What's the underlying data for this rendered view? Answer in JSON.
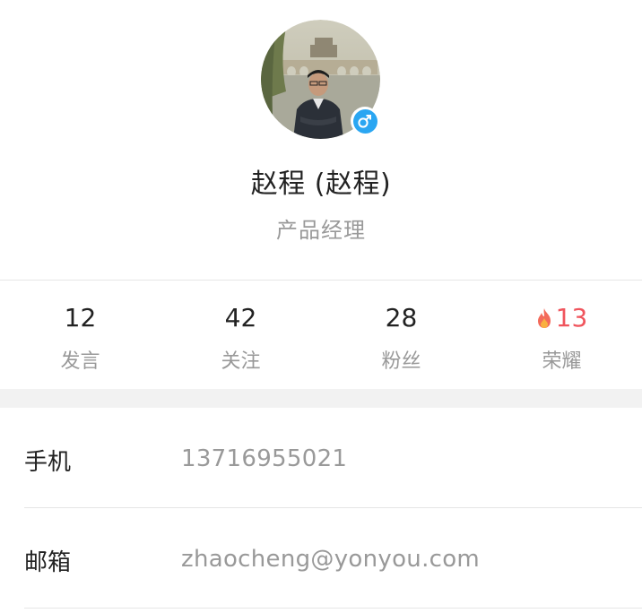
{
  "profile": {
    "name": "赵程 (赵程)",
    "title": "产品经理",
    "avatar_icon": "user-photo",
    "gender_icon": "male-icon",
    "badge_color": "#2aa6f2"
  },
  "stats": [
    {
      "value": "12",
      "label": "发言"
    },
    {
      "value": "42",
      "label": "关注"
    },
    {
      "value": "28",
      "label": "粉丝"
    },
    {
      "value": "13",
      "label": "荣耀",
      "icon": "flame-icon",
      "color": "#f0555d"
    }
  ],
  "info": {
    "phone": {
      "label": "手机",
      "value": "13716955021"
    },
    "email": {
      "label": "邮箱",
      "value": "zhaocheng@yonyou.com"
    }
  }
}
